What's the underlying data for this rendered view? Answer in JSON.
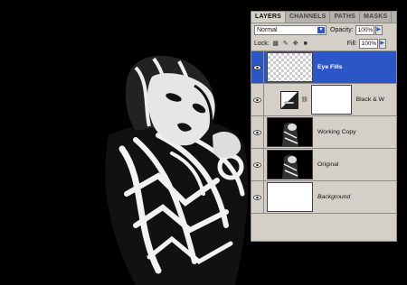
{
  "panel": {
    "tabs": [
      "LAYERS",
      "CHANNELS",
      "PATHS",
      "MASKS"
    ],
    "blend_mode": "Normal",
    "opacity_label": "Opacity:",
    "opacity_value": "100%",
    "lock_label": "Lock:",
    "fill_label": "Fill:",
    "fill_value": "100%",
    "layers": [
      {
        "name": "Eye Fills",
        "selected": true
      },
      {
        "name": "Black & W",
        "selected": false
      },
      {
        "name": "Working Copy",
        "selected": false
      },
      {
        "name": "Original",
        "selected": false
      },
      {
        "name": "Background",
        "selected": false
      }
    ]
  },
  "colors": {
    "selection": "#2a56c6",
    "panel_bg": "#d4d0c8"
  }
}
